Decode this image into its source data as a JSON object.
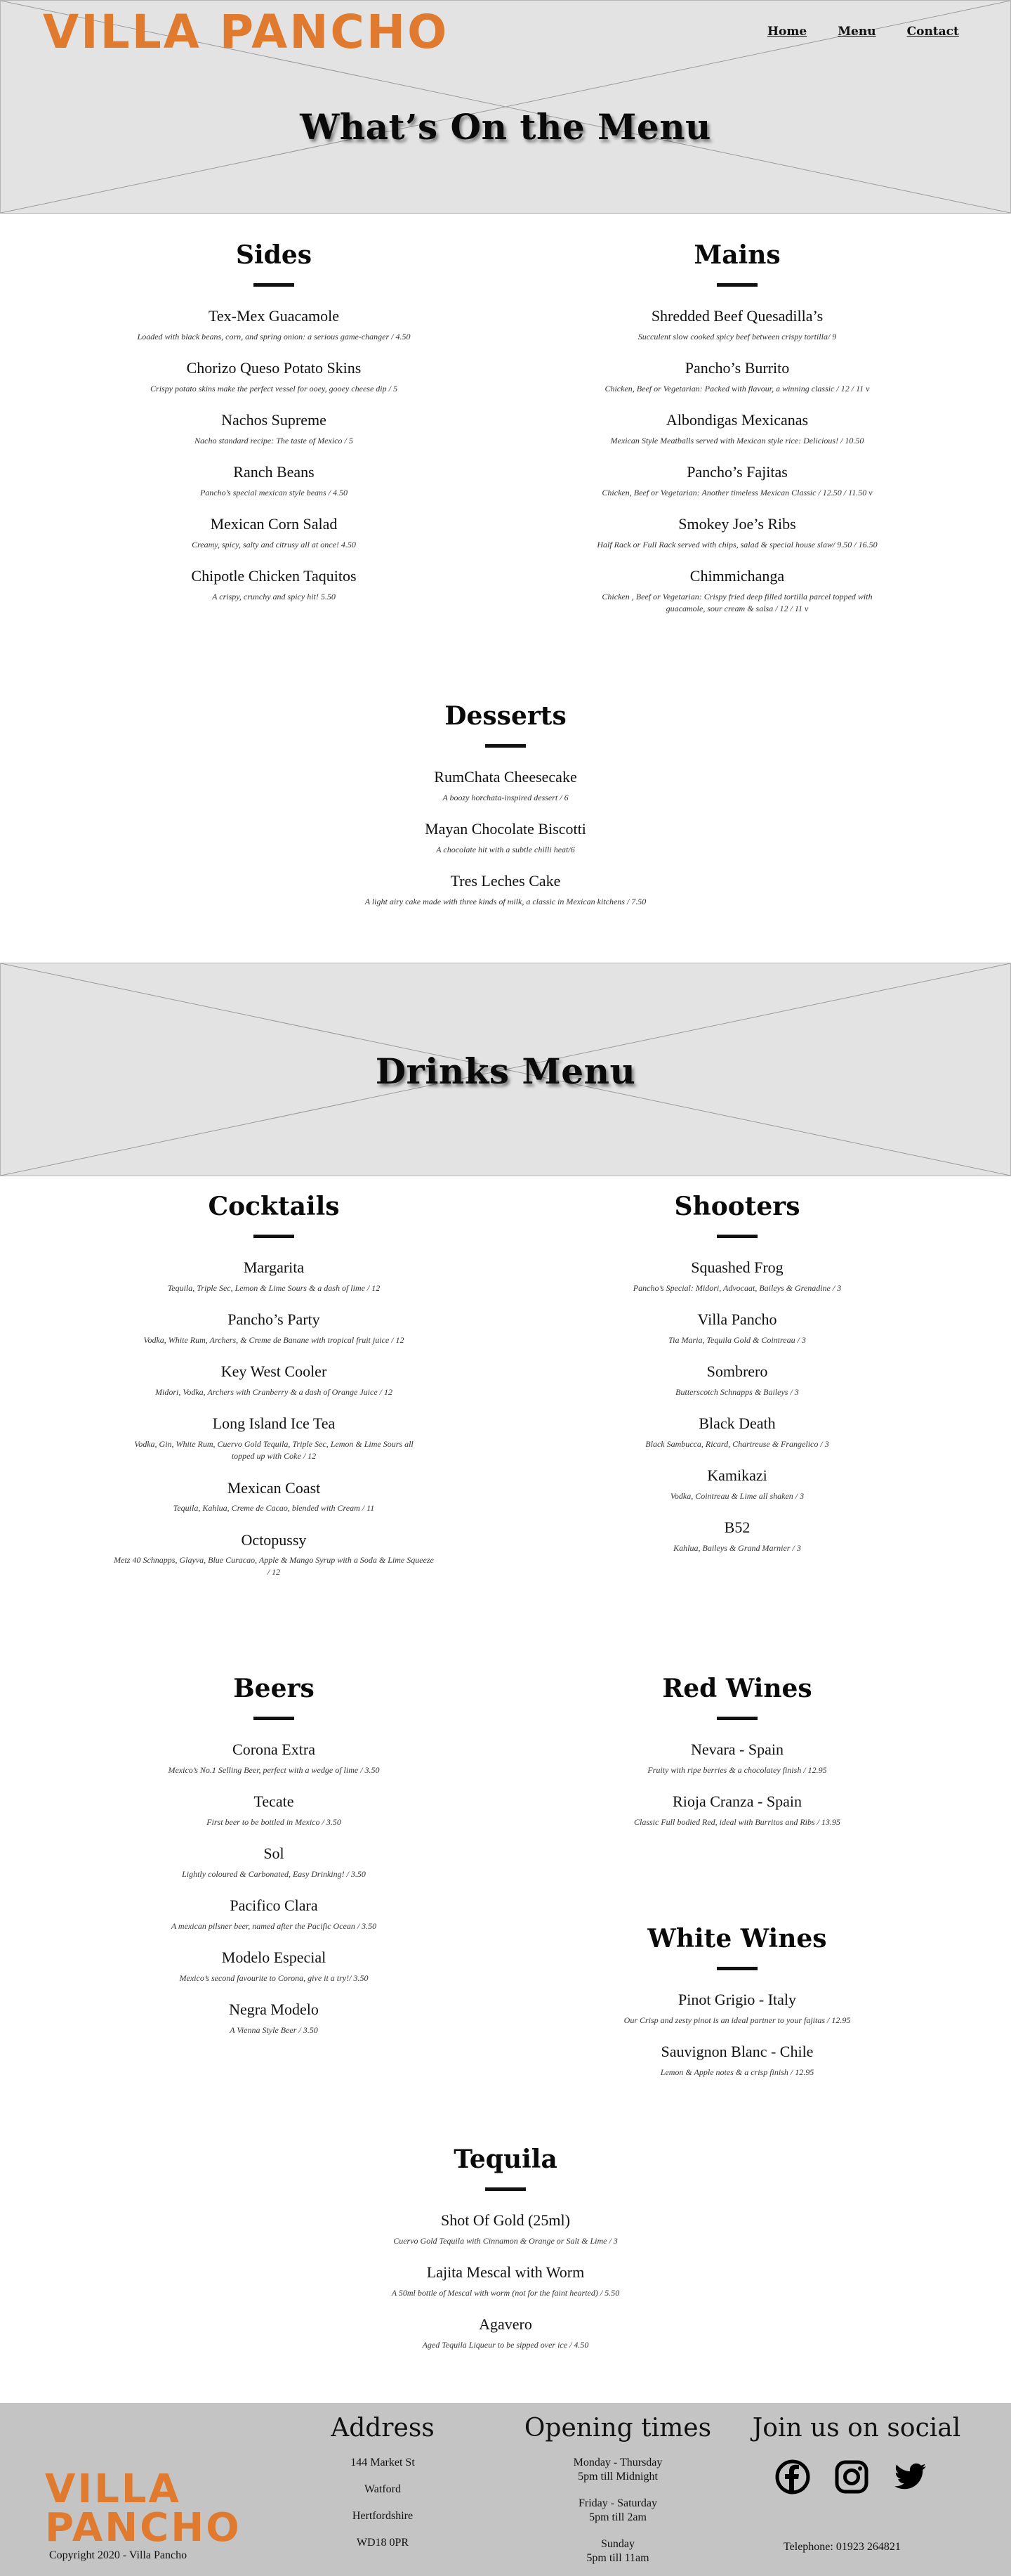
{
  "brand": {
    "name_line1": "VILLA",
    "name_line2": "PANCHO",
    "header_logo": "VILLA PANCHO",
    "color": "#e07a2e"
  },
  "nav": {
    "home": "Home",
    "menu": "Menu",
    "contact": "Contact"
  },
  "hero1": {
    "title": "What’s On the Menu"
  },
  "hero2": {
    "title": "Drinks Menu"
  },
  "sides": {
    "title": "Sides",
    "items": [
      {
        "name": "Tex-Mex Guacamole",
        "desc": "Loaded with black beans, corn, and spring onion: a serious game-changer / 4.50"
      },
      {
        "name": "Chorizo Queso Potato Skins",
        "desc": "Crispy potato skins make the perfect vessel for ooey, gooey cheese dip / 5"
      },
      {
        "name": "Nachos Supreme",
        "desc": "Nacho standard recipe: The taste of Mexico / 5"
      },
      {
        "name": "Ranch Beans",
        "desc": "Pancho’s special mexican style beans / 4.50"
      },
      {
        "name": "Mexican Corn Salad",
        "desc": "Creamy, spicy, salty and citrusy all at once! 4.50"
      },
      {
        "name": "Chipotle Chicken Taquitos",
        "desc": "A crispy, crunchy and spicy hit! 5.50"
      }
    ]
  },
  "mains": {
    "title": "Mains",
    "items": [
      {
        "name": "Shredded Beef Quesadilla’s",
        "desc": "Succulent slow cooked spicy beef between crispy tortilla/ 9"
      },
      {
        "name": "Pancho’s Burrito",
        "desc": "Chicken, Beef or Vegetarian: Packed with flavour, a winning classic / 12 / 11 v"
      },
      {
        "name": "Albondigas Mexicanas",
        "desc": "Mexican Style Meatballs served with Mexican style rice: Delicious! / 10.50"
      },
      {
        "name": "Pancho’s Fajitas",
        "desc": "Chicken, Beef or Vegetarian: Another timeless Mexican Classic / 12.50 / 11.50 v"
      },
      {
        "name": "Smokey Joe’s Ribs",
        "desc": "Half Rack or Full Rack served with chips, salad & special house slaw/ 9.50 / 16.50"
      },
      {
        "name": "Chimmichanga",
        "desc": "Chicken , Beef or Vegetarian: Crispy fried deep filled tortilla parcel topped with guacamole, sour cream & salsa / 12 / 11 v"
      }
    ]
  },
  "desserts": {
    "title": "Desserts",
    "items": [
      {
        "name": "RumChata Cheesecake",
        "desc": "A boozy horchata-inspired dessert / 6"
      },
      {
        "name": "Mayan Chocolate Biscotti",
        "desc": "A chocolate hit with a subtle chilli heat/6"
      },
      {
        "name": "Tres Leches Cake",
        "desc": "A light airy cake made with three kinds of milk, a classic in Mexican kitchens / 7.50"
      }
    ]
  },
  "cocktails": {
    "title": "Cocktails",
    "items": [
      {
        "name": "Margarita",
        "desc": "Tequila, Triple Sec, Lemon & Lime Sours & a dash of lime / 12"
      },
      {
        "name": "Pancho’s Party",
        "desc": "Vodka, White Rum, Archers, & Creme de Banane with tropical fruit juice / 12"
      },
      {
        "name": "Key West Cooler",
        "desc": "Midori, Vodka, Archers with Cranberry & a dash of Orange Juice / 12"
      },
      {
        "name": "Long Island Ice Tea",
        "desc": "Vodka, Gin, White Rum, Cuervo Gold Tequila, Triple Sec, Lemon & Lime Sours all topped up with Coke / 12"
      },
      {
        "name": "Mexican Coast",
        "desc": "Tequila, Kahlua, Creme de Cacao, blended with Cream / 11"
      },
      {
        "name": "Octopussy",
        "desc": "Metz 40 Schnapps, Glayva, Blue Curacao, Apple & Mango Syrup with a Soda & Lime Squeeze / 12"
      }
    ]
  },
  "shooters": {
    "title": "Shooters",
    "items": [
      {
        "name": "Squashed Frog",
        "desc": "Pancho’s Special: Midori, Advocaat, Baileys & Grenadine / 3"
      },
      {
        "name": "Villa Pancho",
        "desc": "Tia Maria, Tequila Gold & Cointreau / 3"
      },
      {
        "name": "Sombrero",
        "desc": "Butterscotch Schnapps & Baileys / 3"
      },
      {
        "name": "Black Death",
        "desc": "Black Sambucca, Ricard, Chartreuse & Frangelico / 3"
      },
      {
        "name": "Kamikazi",
        "desc": "Vodka, Cointreau & Lime all shaken / 3"
      },
      {
        "name": "B52",
        "desc": "Kahlua, Baileys & Grand Marnier / 3"
      }
    ]
  },
  "beers": {
    "title": "Beers",
    "items": [
      {
        "name": "Corona Extra",
        "desc": "Mexico’s No.1 Selling Beer, perfect with a wedge of lime / 3.50"
      },
      {
        "name": "Tecate",
        "desc": "First beer to be bottled in Mexico / 3.50"
      },
      {
        "name": "Sol",
        "desc": "Lightly coloured & Carbonated, Easy Drinking! / 3.50"
      },
      {
        "name": "Pacifico Clara",
        "desc": "A mexican pilsner beer, named after the Pacific Ocean / 3.50"
      },
      {
        "name": "Modelo Especial",
        "desc": "Mexico’s second favourite to Corona, give it a try!/ 3.50"
      },
      {
        "name": "Negra Modelo",
        "desc": "A Vienna Style Beer / 3.50"
      }
    ]
  },
  "red_wines": {
    "title": "Red Wines",
    "items": [
      {
        "name": "Nevara - Spain",
        "desc": "Fruity with ripe berries & a chocolatey finish / 12.95"
      },
      {
        "name": "Rioja Cranza - Spain",
        "desc": "Classic Full bodied Red, ideal with Burritos and Ribs / 13.95"
      }
    ]
  },
  "white_wines": {
    "title": "White Wines",
    "items": [
      {
        "name": "Pinot Grigio - Italy",
        "desc": "Our Crisp and zesty pinot is an ideal partner to your fajitas / 12.95"
      },
      {
        "name": "Sauvignon Blanc - Chile",
        "desc": "Lemon & Apple notes & a crisp finish / 12.95"
      }
    ]
  },
  "tequila": {
    "title": "Tequila",
    "items": [
      {
        "name": "Shot Of Gold (25ml)",
        "desc": "Cuervo Gold Tequila with Cinnamon & Orange or Salt & Lime / 3"
      },
      {
        "name": "Lajita Mescal with Worm",
        "desc": "A 50ml bottle of Mescal with worm (not for the faint hearted) / 5.50"
      },
      {
        "name": "Agavero",
        "desc": "Aged Tequila Liqueur to be sipped over ice / 4.50"
      }
    ]
  },
  "footer": {
    "address_title": "Address",
    "address_lines": [
      "144 Market St",
      "Watford",
      "Hertfordshire",
      "WD18 0PR"
    ],
    "hours_title": "Opening times",
    "hours": [
      {
        "days": "Monday - Thursday",
        "time": "5pm till Midnight"
      },
      {
        "days": "Friday - Saturday",
        "time": "5pm till 2am"
      },
      {
        "days": "Sunday",
        "time": "5pm till 11am"
      }
    ],
    "social_title": "Join us on social",
    "social_icons": [
      "facebook-icon",
      "instagram-icon",
      "twitter-icon"
    ],
    "copyright": "Copyright 2020 - Villa Pancho",
    "phone": "Telephone: 01923 264821"
  }
}
